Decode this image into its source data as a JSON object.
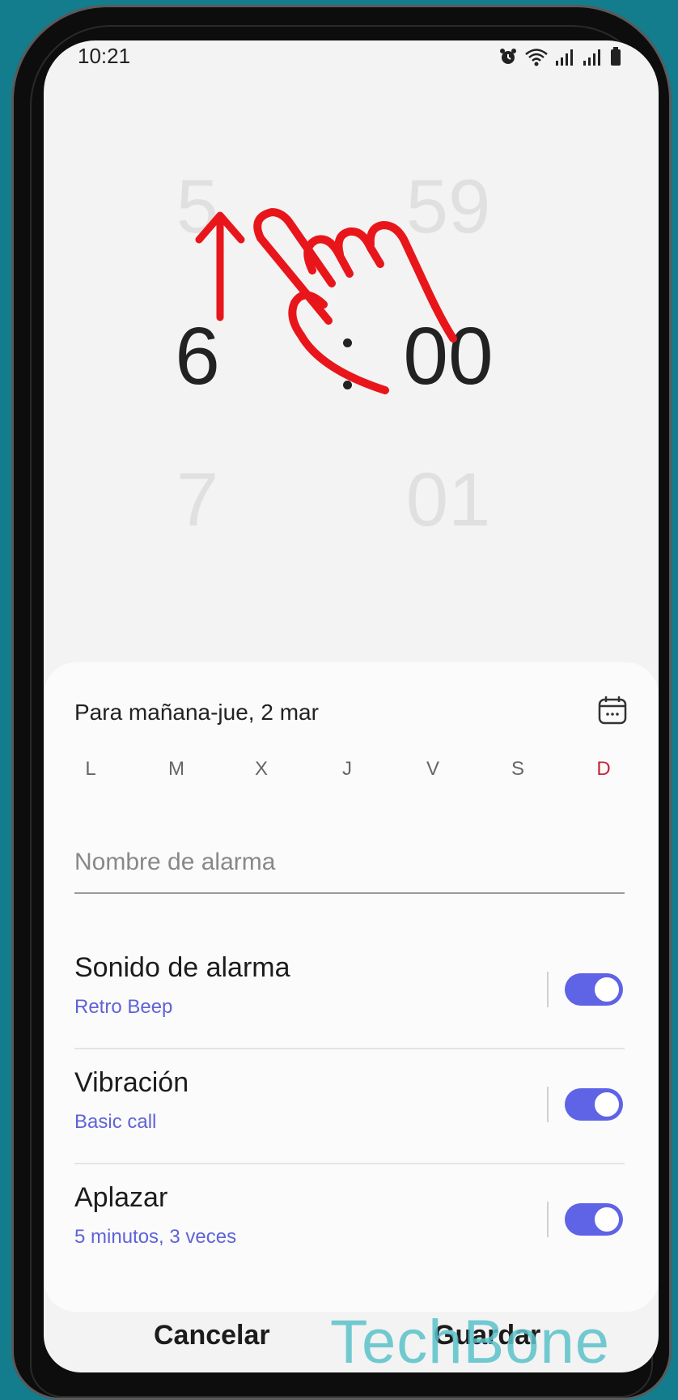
{
  "status_bar": {
    "time": "10:21",
    "icons": [
      "alarm-icon",
      "wifi-icon",
      "signal-icon",
      "signal-icon",
      "battery-icon"
    ]
  },
  "time_picker": {
    "hour_prev": "5",
    "hour_current": "6",
    "hour_next": "7",
    "minute_prev": "59",
    "minute_current": "00",
    "minute_next": "01",
    "separator": ":"
  },
  "schedule": {
    "date_label": "Para mañana-jue, 2 mar",
    "days": [
      "L",
      "M",
      "X",
      "J",
      "V",
      "S",
      "D"
    ],
    "sunday_color": "#c7263b"
  },
  "alarm_name": {
    "placeholder": "Nombre de alarma",
    "value": ""
  },
  "settings": [
    {
      "title": "Sonido de alarma",
      "subtitle": "Retro Beep",
      "enabled": true
    },
    {
      "title": "Vibración",
      "subtitle": "Basic call",
      "enabled": true
    },
    {
      "title": "Aplazar",
      "subtitle": "5 minutos, 3 veces",
      "enabled": true
    }
  ],
  "actions": {
    "cancel_label": "Cancelar",
    "save_label": "Guardar"
  },
  "watermark": "TechBone",
  "colors": {
    "accent": "#5f63e6",
    "subtitle": "#5f63d8",
    "background": "#137c8d",
    "gesture": "#e8161b"
  }
}
